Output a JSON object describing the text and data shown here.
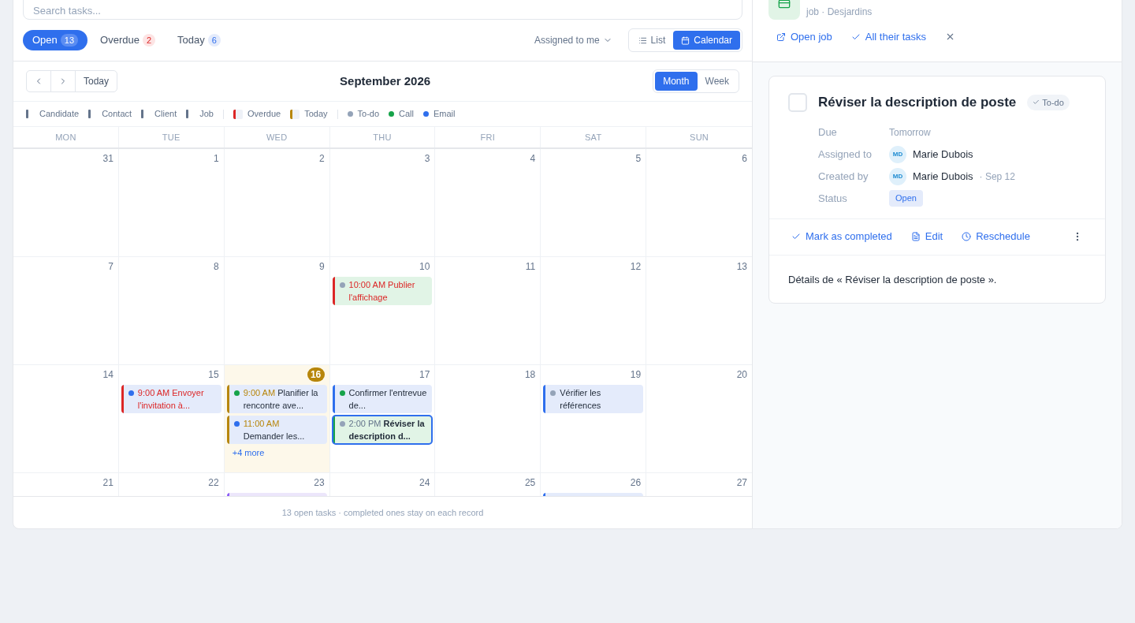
{
  "search": {
    "placeholder": "Search tasks..."
  },
  "filters": [
    {
      "label": "Open",
      "count": "13",
      "selected": true,
      "kind": "open"
    },
    {
      "label": "Overdue",
      "count": "2",
      "selected": false,
      "kind": "overdue"
    },
    {
      "label": "Today",
      "count": "6",
      "selected": false,
      "kind": "today"
    }
  ],
  "assignee_menu": {
    "label": "Assigned to me"
  },
  "views": [
    {
      "label": "List",
      "kind": "list",
      "selected": false
    },
    {
      "label": "Calendar",
      "kind": "calendar",
      "selected": true
    }
  ],
  "calendar": {
    "today_button": "Today",
    "title": "September 2026",
    "modes": [
      {
        "label": "Month",
        "selected": true
      },
      {
        "label": "Week",
        "selected": false
      }
    ],
    "legend": [
      {
        "label": "Candidate",
        "kind": "edge",
        "color": "#64748b"
      },
      {
        "label": "Contact",
        "kind": "edge",
        "color": "#64748b"
      },
      {
        "label": "Client",
        "kind": "edge",
        "color": "#64748b"
      },
      {
        "label": "Job",
        "kind": "edge",
        "color": "#64748b"
      },
      {
        "label": "Overdue",
        "kind": "status",
        "color": "#dc2626"
      },
      {
        "label": "Today",
        "kind": "status",
        "color": "#b7860b"
      },
      {
        "label": "To-do",
        "kind": "dot",
        "color": "#94a3b8"
      },
      {
        "label": "Call",
        "kind": "dot",
        "color": "#16a34a"
      },
      {
        "label": "Email",
        "kind": "dot",
        "color": "#2f6fed"
      }
    ],
    "weekdays": [
      "MON",
      "TUE",
      "WED",
      "THU",
      "FRI",
      "SAT",
      "SUN"
    ],
    "weeks": [
      {
        "days": [
          {
            "day": "31",
            "today": false
          },
          {
            "day": "1",
            "today": false
          },
          {
            "day": "2",
            "today": false
          },
          {
            "day": "3",
            "today": false
          },
          {
            "day": "4",
            "today": false
          },
          {
            "day": "5",
            "today": false
          },
          {
            "day": "6",
            "today": false
          }
        ]
      },
      {
        "days": [
          {
            "day": "7",
            "today": false
          },
          {
            "day": "8",
            "today": false
          },
          {
            "day": "9",
            "today": false
          },
          {
            "day": "10",
            "today": false,
            "events": [
              {
                "kind": "todo",
                "overdue": true,
                "due_today": false,
                "color": "#dc2626",
                "record": {
                  "kind": "job"
                },
                "time": "10:00 AM",
                "title": "Publier l'affichage",
                "selected": false
              }
            ]
          },
          {
            "day": "11",
            "today": false
          },
          {
            "day": "12",
            "today": false
          },
          {
            "day": "13",
            "today": false
          }
        ]
      },
      {
        "days": [
          {
            "day": "14",
            "today": false
          },
          {
            "day": "15",
            "today": false,
            "events": [
              {
                "kind": "email",
                "overdue": true,
                "due_today": false,
                "color": "#dc2626",
                "record": {
                  "kind": "candidate"
                },
                "time": "9:00 AM",
                "title": "Envoyer l'invitation à...",
                "selected": false
              }
            ]
          },
          {
            "day": "16",
            "today": true,
            "events": [
              {
                "kind": "call",
                "overdue": false,
                "due_today": true,
                "color": "#b7860b",
                "record": {
                  "kind": "candidate"
                },
                "time": "9:00 AM",
                "title": "Planifier la rencontre ave...",
                "selected": false
              },
              {
                "kind": "email",
                "overdue": false,
                "due_today": true,
                "color": "#b7860b",
                "record": {
                  "kind": "candidate"
                },
                "time": "11:00 AM",
                "title": "Demander les...",
                "selected": false
              }
            ],
            "more": "+4 more"
          },
          {
            "day": "17",
            "today": false,
            "events": [
              {
                "kind": "call",
                "overdue": false,
                "due_today": false,
                "color": "#2f6fed",
                "record": {
                  "kind": "candidate"
                },
                "title": "Confirmer l'entrevue de...",
                "selected": false
              },
              {
                "kind": "todo",
                "overdue": false,
                "due_today": false,
                "color": "#16a34a",
                "record": {
                  "kind": "job"
                },
                "time": "2:00 PM",
                "title": "Réviser la description d...",
                "selected": true
              }
            ]
          },
          {
            "day": "18",
            "today": false
          },
          {
            "day": "19",
            "today": false,
            "events": [
              {
                "kind": "todo",
                "overdue": false,
                "due_today": false,
                "color": "#2f6fed",
                "record": {
                  "kind": "candidate"
                },
                "title": "Vérifier les références",
                "selected": false
              }
            ]
          },
          {
            "day": "20",
            "today": false
          }
        ]
      },
      {
        "days": [
          {
            "day": "21",
            "today": false
          },
          {
            "day": "22",
            "today": false
          },
          {
            "day": "23",
            "today": false,
            "events": [
              {
                "color": "#8b5cf6",
                "record": {
                  "kind": "client"
                },
                "selected": false
              }
            ]
          },
          {
            "day": "24",
            "today": false
          },
          {
            "day": "25",
            "today": false
          },
          {
            "day": "26",
            "today": false,
            "events": [
              {
                "color": "#2f6fed",
                "record": {
                  "kind": "candidate"
                },
                "selected": false
              }
            ]
          },
          {
            "day": "27",
            "today": false
          }
        ]
      }
    ],
    "footer": "13 open tasks · completed ones stay on each record"
  },
  "record": {
    "subtitle": "job · Desjardins",
    "actions": [
      {
        "label": "Open job",
        "kind": "open"
      },
      {
        "label": "All their tasks",
        "kind": "check"
      }
    ]
  },
  "task": {
    "title": "Réviser la description de poste",
    "checked": false,
    "type_badge": "To-do",
    "fields": [
      {
        "label": "Due",
        "kind": "text",
        "value": "Tomorrow"
      },
      {
        "label": "Assigned to",
        "kind": "person",
        "initials": "MD",
        "value": "Marie Dubois"
      },
      {
        "label": "Created by",
        "kind": "person",
        "initials": "MD",
        "value": "Marie Dubois",
        "note": "· Sep 12"
      },
      {
        "label": "Status",
        "kind": "badge",
        "value": "Open"
      }
    ],
    "actions": [
      {
        "label": "Mark as completed",
        "kind": "check"
      },
      {
        "label": "Edit",
        "kind": "edit"
      },
      {
        "label": "Reschedule",
        "kind": "clock"
      }
    ],
    "details": "Détails de « Réviser la description de poste »."
  }
}
